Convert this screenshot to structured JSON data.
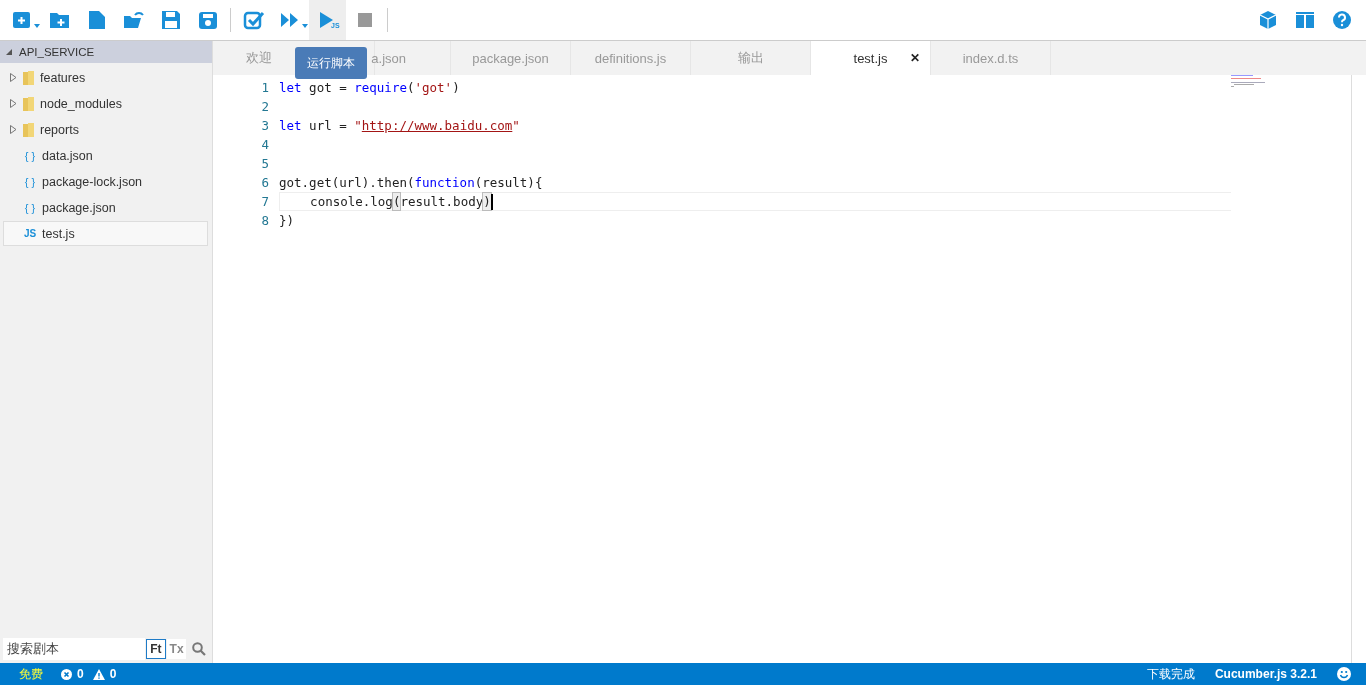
{
  "toolbar": {
    "left": [
      {
        "kind": "new",
        "caret": true
      },
      {
        "kind": "new-folder"
      },
      {
        "kind": "file"
      },
      {
        "kind": "open"
      },
      {
        "kind": "save"
      },
      {
        "kind": "save-as"
      },
      {
        "kind": "sep"
      },
      {
        "kind": "check"
      },
      {
        "kind": "run-all",
        "caret": true
      },
      {
        "kind": "run",
        "badge": "JS",
        "selected": true
      },
      {
        "kind": "stop",
        "disabled": true
      },
      {
        "kind": "sep"
      }
    ],
    "right": [
      {
        "kind": "cube"
      },
      {
        "kind": "layout"
      },
      {
        "kind": "help"
      }
    ]
  },
  "tooltip": "运行脚本",
  "sidebar": {
    "title": "API_SERVICE",
    "expanded": true,
    "items": [
      {
        "name": "features",
        "kind": "folder",
        "expanded": false,
        "selected": false
      },
      {
        "name": "node_modules",
        "kind": "folder",
        "expanded": false,
        "selected": false
      },
      {
        "name": "reports",
        "kind": "folder",
        "expanded": false,
        "selected": false
      },
      {
        "name": "data.json",
        "kind": "json",
        "icon_label": "{ }",
        "selected": false
      },
      {
        "name": "package-lock.json",
        "kind": "json",
        "icon_label": "{ }",
        "selected": false
      },
      {
        "name": "package.json",
        "kind": "json",
        "icon_label": "{ }",
        "selected": false
      },
      {
        "name": "test.js",
        "kind": "js",
        "icon_label": "JS",
        "selected": true
      }
    ],
    "search": {
      "placeholder": "搜索剧本",
      "options": [
        {
          "label": "Ft",
          "selected": true
        },
        {
          "label": "Tx",
          "selected": false
        }
      ]
    }
  },
  "tabs": [
    {
      "label": "欢迎",
      "selected": false
    },
    {
      "label": "a.json",
      "selected": false
    },
    {
      "label": "package.json",
      "selected": false
    },
    {
      "label": "definitions.js",
      "selected": false
    },
    {
      "label": "输出",
      "selected": false
    },
    {
      "label": "test.js",
      "selected": true,
      "close": "✕"
    },
    {
      "label": "index.d.ts",
      "selected": false
    }
  ],
  "editor": {
    "lines": [
      {
        "no": "1",
        "tokens": [
          {
            "text": "let",
            "kind": "keyword"
          },
          {
            "text": " got = ",
            "kind": "plain"
          },
          {
            "text": "require",
            "kind": "keyword"
          },
          {
            "text": "(",
            "kind": "plain"
          },
          {
            "text": "'got'",
            "kind": "string"
          },
          {
            "text": ")",
            "kind": "plain"
          }
        ]
      },
      {
        "no": "2"
      },
      {
        "no": "3",
        "tokens": [
          {
            "text": "let",
            "kind": "keyword"
          },
          {
            "text": " url = ",
            "kind": "plain"
          },
          {
            "text": "\"",
            "kind": "string"
          },
          {
            "text": "http://www.baidu.com",
            "kind": "link"
          },
          {
            "text": "\"",
            "kind": "string"
          }
        ]
      },
      {
        "no": "4"
      },
      {
        "no": "5"
      },
      {
        "no": "6",
        "tokens": [
          {
            "text": "got.get(url).then(",
            "kind": "plain"
          },
          {
            "text": "function",
            "kind": "keyword"
          },
          {
            "text": "(result){",
            "kind": "plain"
          }
        ]
      },
      {
        "no": "7",
        "current": true,
        "tokens": [
          {
            "text": "    console.log",
            "kind": "plain"
          },
          {
            "text": "(",
            "kind": "bracket"
          },
          {
            "text": "result.body",
            "kind": "plain"
          },
          {
            "text": ")",
            "kind": "bracket"
          }
        ]
      },
      {
        "no": "8",
        "tokens": [
          {
            "text": "})",
            "kind": "plain"
          }
        ]
      }
    ]
  },
  "status_bar": {
    "plan": "免费",
    "errors": "0",
    "warnings": "0",
    "message": "下载完成",
    "version": "Cucumber.js 3.2.1"
  }
}
